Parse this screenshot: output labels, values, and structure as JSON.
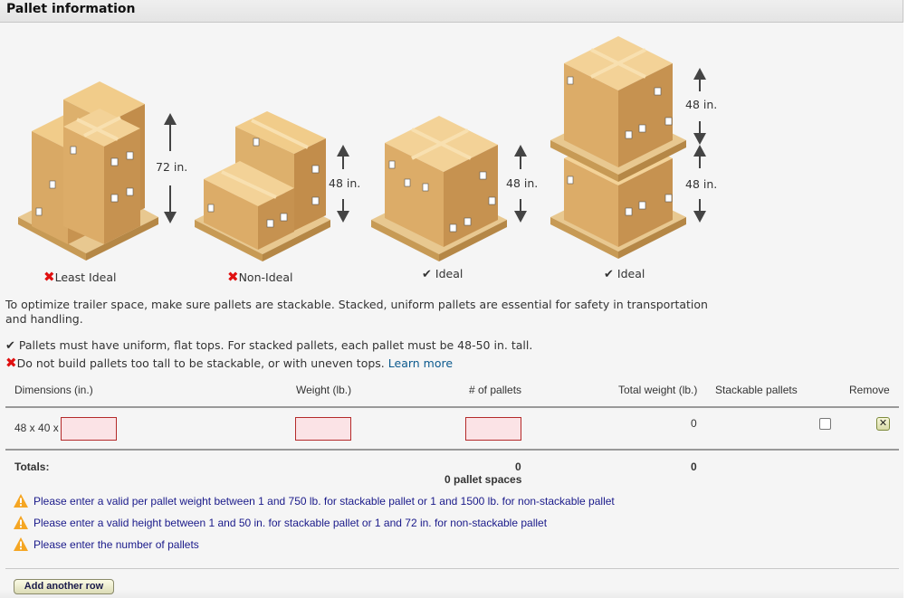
{
  "panel": {
    "title": "Pallet information"
  },
  "illustrations": [
    {
      "label": "Least Ideal",
      "status": "bad",
      "status_icon": "x-icon",
      "heights": [
        "72 in."
      ]
    },
    {
      "label": "Non-Ideal",
      "status": "bad",
      "status_icon": "x-icon",
      "heights": [
        "48 in."
      ]
    },
    {
      "label": "Ideal",
      "status": "good",
      "status_icon": "check-icon",
      "heights": [
        "48 in."
      ]
    },
    {
      "label": "Ideal",
      "status": "good",
      "status_icon": "check-icon",
      "heights": [
        "48 in.",
        "48 in."
      ]
    }
  ],
  "symbols": {
    "check": "✔",
    "x": "✖"
  },
  "intro": "To optimize trailer space, make sure pallets are stackable. Stacked, uniform pallets are essential for safety in transportation and handling.",
  "rules": {
    "good": "Pallets must have uniform, flat tops. For stacked pallets, each pallet must be 48-50 in. tall.",
    "bad": "Do not build pallets too tall to be stackable, or with uneven tops.",
    "learn_more": "Learn more"
  },
  "table": {
    "headers": {
      "dimensions": "Dimensions (in.)",
      "weight": "Weight (lb.)",
      "pallets": "# of pallets",
      "total_weight": "Total weight (lb.)",
      "stackable": "Stackable pallets",
      "remove": "Remove"
    },
    "rows": [
      {
        "dimensions_prefix": "48 x 40 x",
        "height_value": "",
        "weight_value": "",
        "pallets_value": "",
        "total_weight": "0",
        "stackable": false,
        "remove_glyph": "✕"
      }
    ],
    "totals": {
      "label": "Totals:",
      "pallets": "0",
      "pallet_spaces": "0 pallet spaces",
      "total_weight": "0"
    }
  },
  "warnings": [
    "Please enter a valid per pallet weight between 1 and 750 lb. for stackable pallet or 1 and 1500 lb. for non-stackable pallet",
    "Please enter a valid height between 1 and 50 in. for stackable pallet or 1 and 72 in. for non-stackable pallet",
    "Please enter the number of pallets"
  ],
  "buttons": {
    "add_row": "Add another row"
  },
  "colors": {
    "error_border": "#b42a2a",
    "error_fill": "#fbe3e6",
    "warning_text": "#1a1a8a",
    "link": "#0c5a8e",
    "x_mark": "#e01010",
    "warning_icon": "#f5a623"
  }
}
